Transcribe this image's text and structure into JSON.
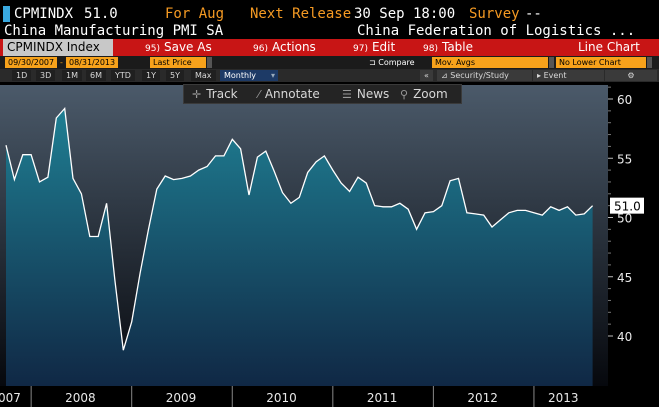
{
  "header": {
    "ticker": "CPMINDX",
    "last_value": "51.0",
    "period_label": "For Aug",
    "next_release_label": "Next Release",
    "next_release_value": "30 Sep 18:00",
    "survey_label": "Survey",
    "survey_value": "--"
  },
  "description": {
    "name": "China Manufacturing PMI SA",
    "source": "China Federation of Logistics ..."
  },
  "actions": {
    "ticker_field": "CPMINDX Index",
    "save_as_num": "95)",
    "save_as_label": "Save As",
    "actions_num": "96)",
    "actions_label": "Actions",
    "edit_num": "97)",
    "edit_label": "Edit",
    "table_num": "98)",
    "table_label": "Table",
    "chart_type": "Line Chart"
  },
  "range": {
    "start_date": "09/30/2007",
    "end_date": "08/31/2013",
    "price_field": "Last Price",
    "compare_label": "Compare",
    "mov_avgs_label": "Mov. Avgs",
    "lower_chart_value": "No Lower Chart"
  },
  "periods": {
    "buttons": [
      "1D",
      "3D",
      "1M",
      "6M",
      "YTD",
      "1Y",
      "5Y",
      "Max"
    ],
    "selected": "Monthly",
    "collapse_label": "«",
    "security_study_label": "Security/Study",
    "event_label": "Event",
    "settings_label": "⚙"
  },
  "tools": {
    "track": "Track",
    "annotate": "Annotate",
    "news": "News",
    "zoom": "Zoom"
  },
  "colors": {
    "accent_orange": "#f59a23",
    "toolbar_red": "#c81515",
    "line": "#ffffff",
    "area_top": "#1f7f93",
    "area_bottom": "#102845",
    "bg_top": "#4b5a6a",
    "bg_bottom": "#06080d"
  },
  "chart_data": {
    "type": "area",
    "title": "",
    "xlabel": "",
    "ylabel": "",
    "ylim": [
      37,
      62
    ],
    "y_ticks": [
      40,
      45,
      50,
      55,
      60
    ],
    "x_tick_labels": [
      "2007",
      "2008",
      "2009",
      "2010",
      "2011",
      "2012",
      "2013"
    ],
    "last_value_label": "51.0",
    "series": [
      {
        "values": [
          56.1,
          53.2,
          55.3,
          55.3,
          53.0,
          53.4,
          58.4,
          59.2,
          53.3,
          52.0,
          48.4,
          48.4,
          51.2,
          44.7,
          38.8,
          41.2,
          45.3,
          49.0,
          52.4,
          53.5,
          53.2,
          53.3,
          53.5,
          54.0,
          54.3,
          55.2,
          55.2,
          56.6,
          55.8,
          51.9,
          55.1,
          55.6,
          53.9,
          52.1,
          51.2,
          51.7,
          53.8,
          54.7,
          55.2,
          54.0,
          52.9,
          52.2,
          53.4,
          52.9,
          51.0,
          50.9,
          50.9,
          51.2,
          50.7,
          49.0,
          50.4,
          50.5,
          51.0,
          53.1,
          53.3,
          50.4,
          50.3,
          50.2,
          49.2,
          49.8,
          50.4,
          50.6,
          50.6,
          50.4,
          50.2,
          50.9,
          50.6,
          50.9,
          50.2,
          50.3,
          51.0
        ],
        "start": "2007-09",
        "frequency": "monthly"
      }
    ]
  }
}
